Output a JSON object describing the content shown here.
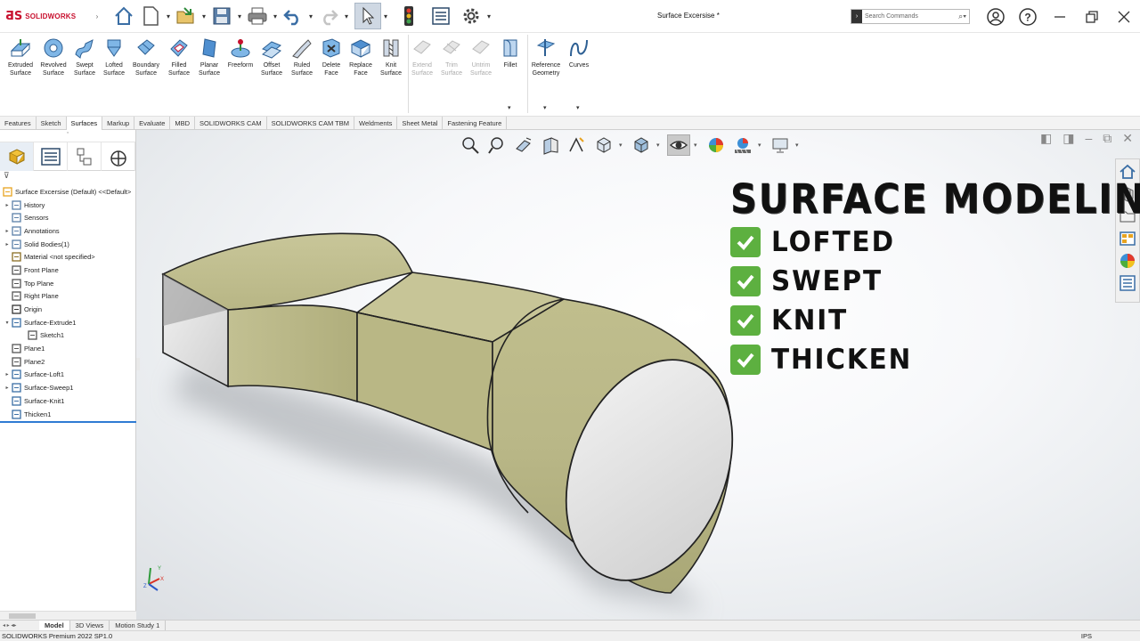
{
  "app": {
    "brand": "SOLIDWORKS",
    "document_title": "Surface Excersise *"
  },
  "search": {
    "placeholder": "Search Commands"
  },
  "ribbon": {
    "buttons": [
      {
        "label": "Extruded\nSurface",
        "icon": "extruded-surface-icon",
        "enabled": true
      },
      {
        "label": "Revolved\nSurface",
        "icon": "revolved-surface-icon",
        "enabled": true
      },
      {
        "label": "Swept\nSurface",
        "icon": "swept-surface-icon",
        "enabled": true
      },
      {
        "label": "Lofted\nSurface",
        "icon": "lofted-surface-icon",
        "enabled": true
      },
      {
        "label": "Boundary\nSurface",
        "icon": "boundary-surface-icon",
        "enabled": true
      },
      {
        "label": "Filled\nSurface",
        "icon": "filled-surface-icon",
        "enabled": true
      },
      {
        "label": "Planar\nSurface",
        "icon": "planar-surface-icon",
        "enabled": true
      },
      {
        "label": "Freeform",
        "icon": "freeform-icon",
        "enabled": true
      },
      {
        "label": "Offset\nSurface",
        "icon": "offset-surface-icon",
        "enabled": true
      },
      {
        "label": "Ruled\nSurface",
        "icon": "ruled-surface-icon",
        "enabled": true
      },
      {
        "label": "Delete\nFace",
        "icon": "delete-face-icon",
        "enabled": true
      },
      {
        "label": "Replace\nFace",
        "icon": "replace-face-icon",
        "enabled": true
      },
      {
        "label": "Knit\nSurface",
        "icon": "knit-surface-icon",
        "enabled": true
      },
      {
        "label": "Extend\nSurface",
        "icon": "extend-surface-icon",
        "enabled": false
      },
      {
        "label": "Trim\nSurface",
        "icon": "trim-surface-icon",
        "enabled": false
      },
      {
        "label": "Untrim\nSurface",
        "icon": "untrim-surface-icon",
        "enabled": false
      },
      {
        "label": "Fillet",
        "icon": "fillet-icon",
        "enabled": true
      },
      {
        "label": "Reference\nGeometry",
        "icon": "reference-geometry-icon",
        "enabled": true
      },
      {
        "label": "Curves",
        "icon": "curves-icon",
        "enabled": true
      }
    ]
  },
  "command_tabs": [
    "Features",
    "Sketch",
    "Surfaces",
    "Markup",
    "Evaluate",
    "MBD",
    "SOLIDWORKS CAM",
    "SOLIDWORKS CAM TBM",
    "Weldments",
    "Sheet Metal",
    "Fastening Feature"
  ],
  "active_command_tab": "Surfaces",
  "feature_tree": [
    {
      "label": "Surface Excersise (Default) <<Default>",
      "expand": "",
      "icon": "part-icon"
    },
    {
      "label": "History",
      "expand": "▸",
      "icon": "history-icon"
    },
    {
      "label": "Sensors",
      "expand": "",
      "icon": "sensors-icon"
    },
    {
      "label": "Annotations",
      "expand": "▸",
      "icon": "annotations-icon"
    },
    {
      "label": "Solid Bodies(1)",
      "expand": "▸",
      "icon": "solid-bodies-icon"
    },
    {
      "label": "Material <not specified>",
      "expand": "",
      "icon": "material-icon"
    },
    {
      "label": "Front Plane",
      "expand": "",
      "icon": "plane-icon"
    },
    {
      "label": "Top Plane",
      "expand": "",
      "icon": "plane-icon"
    },
    {
      "label": "Right Plane",
      "expand": "",
      "icon": "plane-icon"
    },
    {
      "label": "Origin",
      "expand": "",
      "icon": "origin-icon"
    },
    {
      "label": "Surface-Extrude1",
      "expand": "▾",
      "icon": "surface-extrude-icon"
    },
    {
      "label": "Sketch1",
      "expand": "",
      "icon": "sketch-icon",
      "indent": true
    },
    {
      "label": "Plane1",
      "expand": "",
      "icon": "plane-icon"
    },
    {
      "label": "Plane2",
      "expand": "",
      "icon": "plane-icon"
    },
    {
      "label": "Surface-Loft1",
      "expand": "▸",
      "icon": "surface-loft-icon"
    },
    {
      "label": "Surface-Sweep1",
      "expand": "▸",
      "icon": "surface-sweep-icon"
    },
    {
      "label": "Surface-Knit1",
      "expand": "",
      "icon": "surface-knit-icon"
    },
    {
      "label": "Thicken1",
      "expand": "",
      "icon": "thicken-icon"
    }
  ],
  "overlay": {
    "title": "SURFACE MODELING",
    "items": [
      "LOFTED",
      "SWEPT",
      "KNIT",
      "THICKEN"
    ]
  },
  "bottom_tabs": [
    "Model",
    "3D Views",
    "Motion Study 1"
  ],
  "active_bottom_tab": "Model",
  "status": {
    "text": "SOLIDWORKS Premium 2022 SP1.0",
    "units": "IPS"
  },
  "colors": {
    "brand": "#c8102e",
    "model": "#bdbb8a",
    "accent": "#2f7bd3",
    "check": "#5db040"
  }
}
